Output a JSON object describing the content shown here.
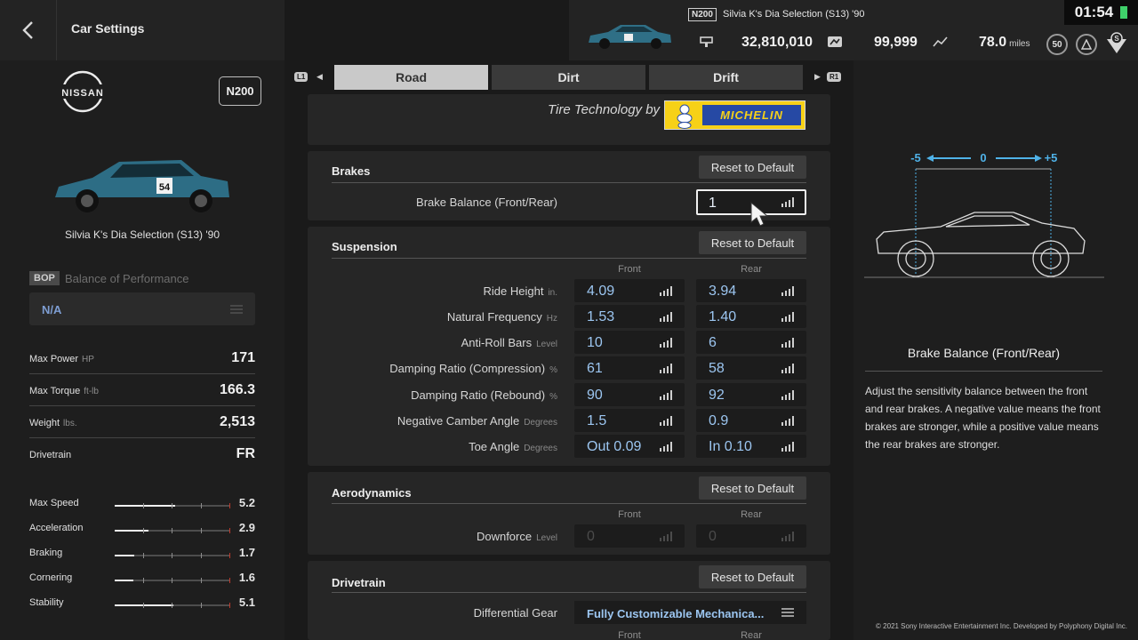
{
  "window": {
    "title": "Car Settings"
  },
  "topbar": {
    "class_badge": "N200",
    "car_name": "Silvia K's Dia Selection (S13) '90",
    "credits": "32,810,010",
    "mileage_points": "99,999",
    "distance": "78.0",
    "distance_unit": "miles",
    "level_badge": "50",
    "clock": "01:54"
  },
  "sidebar": {
    "maker": "NISSAN",
    "class_badge": "N200",
    "car_name": "Silvia K's Dia Selection (S13) '90",
    "bop_tag": "BOP",
    "bop_label": "Balance of Performance",
    "bop_value": "N/A",
    "specs": [
      {
        "label": "Max Power",
        "unit": "HP",
        "value": "171"
      },
      {
        "label": "Max Torque",
        "unit": "ft-lb",
        "value": "166.3"
      },
      {
        "label": "Weight",
        "unit": "lbs.",
        "value": "2,513"
      },
      {
        "label": "Drivetrain",
        "unit": "",
        "value": "FR"
      }
    ],
    "performance": [
      {
        "label": "Max Speed",
        "value": "5.2",
        "fill": 0.52
      },
      {
        "label": "Acceleration",
        "value": "2.9",
        "fill": 0.29
      },
      {
        "label": "Braking",
        "value": "1.7",
        "fill": 0.17
      },
      {
        "label": "Cornering",
        "value": "1.6",
        "fill": 0.16
      },
      {
        "label": "Stability",
        "value": "5.1",
        "fill": 0.51
      }
    ]
  },
  "tabs": {
    "left_button": "L1",
    "right_button": "R1",
    "items": [
      {
        "label": "Road",
        "active": true
      },
      {
        "label": "Dirt",
        "active": false
      },
      {
        "label": "Drift",
        "active": false
      }
    ]
  },
  "tires": {
    "caption": "Tire Technology by",
    "brand": "MICHELIN"
  },
  "brakes": {
    "title": "Brakes",
    "reset_label": "Reset to Default",
    "balance_label": "Brake Balance (Front/Rear)",
    "balance_value": "1"
  },
  "suspension": {
    "title": "Suspension",
    "reset_label": "Reset to Default",
    "front_header": "Front",
    "rear_header": "Rear",
    "rows": [
      {
        "label": "Ride Height",
        "unit": "in.",
        "front": "4.09",
        "rear": "3.94"
      },
      {
        "label": "Natural Frequency",
        "unit": "Hz",
        "front": "1.53",
        "rear": "1.40"
      },
      {
        "label": "Anti-Roll Bars",
        "unit": "Level",
        "front": "10",
        "rear": "6"
      },
      {
        "label": "Damping Ratio (Compression)",
        "unit": "%",
        "front": "61",
        "rear": "58"
      },
      {
        "label": "Damping Ratio (Rebound)",
        "unit": "%",
        "front": "90",
        "rear": "92"
      },
      {
        "label": "Negative Camber Angle",
        "unit": "Degrees",
        "front": "1.5",
        "rear": "0.9"
      },
      {
        "label": "Toe Angle",
        "unit": "Degrees",
        "front": "Out 0.09",
        "rear": "In 0.10"
      }
    ]
  },
  "aero": {
    "title": "Aerodynamics",
    "reset_label": "Reset to Default",
    "front_header": "Front",
    "rear_header": "Rear",
    "downforce_label": "Downforce",
    "downforce_unit": "Level",
    "front": "0",
    "rear": "0"
  },
  "drivetrain": {
    "title": "Drivetrain",
    "reset_label": "Reset to Default",
    "diff_label": "Differential Gear",
    "diff_value": "Fully Customizable Mechanica...",
    "front_header": "Front",
    "rear_header": "Rear"
  },
  "help": {
    "scale_min": "-5",
    "scale_mid": "0",
    "scale_max": "+5",
    "title": "Brake Balance (Front/Rear)",
    "body": "Adjust the sensitivity balance between the front and rear brakes. A negative value means the front brakes are stronger, while a positive value means the rear brakes are stronger."
  },
  "footer": {
    "copyright": "© 2021 Sony Interactive Entertainment Inc. Developed by Polyphony Digital Inc."
  }
}
